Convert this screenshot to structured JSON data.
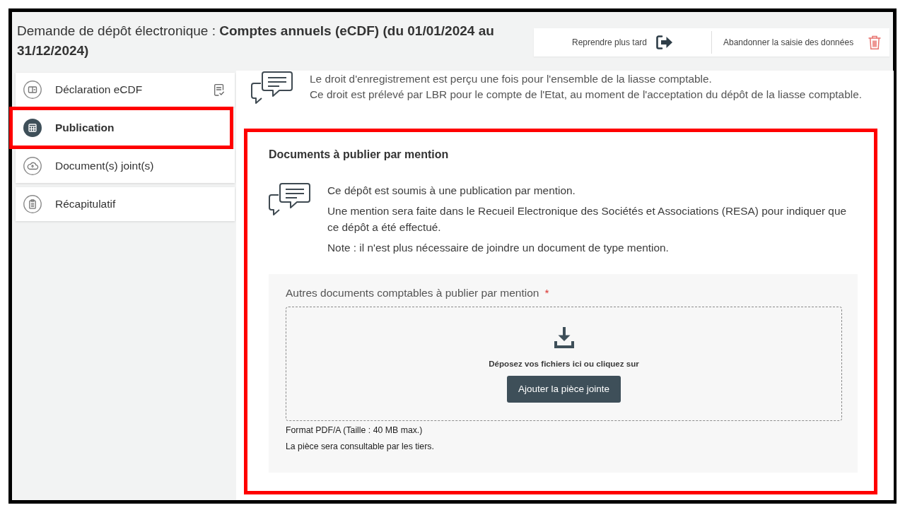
{
  "header": {
    "title": "Demande de dépôt électronique : **Comptes annuels (eCDF) (du 01/01/2024 au 31/12/2024)**",
    "actions": [
      {
        "kind": "resume",
        "label": "Reprendre plus tard"
      },
      {
        "kind": "abandon",
        "label": "Abandonner la saisie des données"
      }
    ]
  },
  "sidebar": {
    "items": [
      {
        "label": "Déclaration eCDF",
        "selected": false,
        "completed": true,
        "highlighted": false
      },
      {
        "label": "Publication",
        "selected": true,
        "completed": false,
        "highlighted": true
      },
      {
        "label": "Document(s) joint(s)",
        "selected": false,
        "completed": false,
        "highlighted": false
      },
      {
        "label": "Récapitulatif",
        "selected": false,
        "completed": false,
        "highlighted": false
      }
    ]
  },
  "fee_notice": {
    "lines": [
      "Le droit d'enregistrement est perçu une fois pour l'ensemble de la liasse comptable.",
      "Ce droit est prélevé par LBR pour le compte de l'Etat, au moment de l'acceptation du dépôt de la liasse comptable."
    ]
  },
  "publication_card": {
    "highlighted": true,
    "title": "Documents à publier par mention",
    "paragraphs": [
      "Ce dépôt est soumis à une publication par mention.",
      "Une mention sera faite dans le Recueil Electronique des Sociétés et Associations (RESA) pour indiquer que ce dépôt a été effectué.",
      "Note : il n'est plus nécessaire de joindre un document de type mention."
    ],
    "upload": {
      "label": "Autres documents comptables à publier par mention",
      "required_mark": "*",
      "drop_hint": "Déposez vos fichiers ici ou cliquez sur",
      "button": "Ajouter la pièce jointe",
      "notes": [
        "Format PDF/A (Taille : 40 MB max.)",
        "La pièce sera consultable par les tiers."
      ]
    }
  }
}
